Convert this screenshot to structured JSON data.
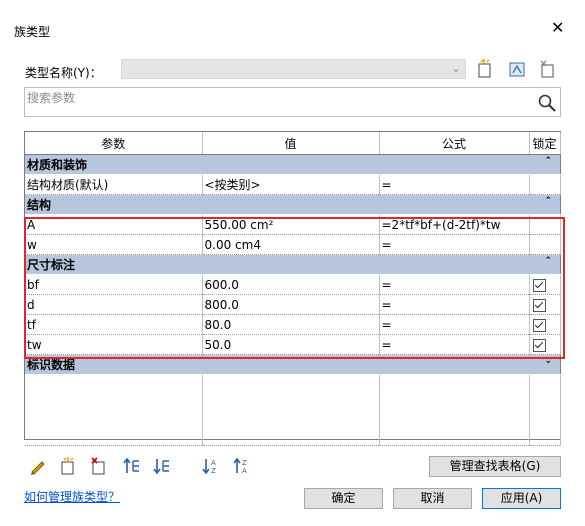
{
  "window": {
    "title": "族类型",
    "close_glyph": "✕"
  },
  "type_name": {
    "label": "类型名称(Y)：",
    "value": ""
  },
  "search": {
    "placeholder": "搜索参数"
  },
  "grid": {
    "headers": [
      "参数",
      "值",
      "公式",
      "锁定"
    ],
    "groups": [
      {
        "label": "材质和装饰",
        "caret": "⌃",
        "rows": [
          {
            "param": "结构材质(默认)",
            "value": "<按类别>",
            "formula": "=",
            "locked": false
          }
        ]
      },
      {
        "label": "结构",
        "caret": "⌃",
        "rows": [
          {
            "param": "A",
            "value": "550.00 cm²",
            "formula": "=2*tf*bf+(d-2tf)*tw",
            "locked": false
          },
          {
            "param": "w",
            "value": "0.00 cm4",
            "formula": "=",
            "locked": false
          }
        ]
      },
      {
        "label": "尺寸标注",
        "caret": "⌃",
        "rows": [
          {
            "param": "bf",
            "value": "600.0",
            "formula": "=",
            "locked": true
          },
          {
            "param": "d",
            "value": "800.0",
            "formula": "=",
            "locked": true
          },
          {
            "param": "tf",
            "value": "80.0",
            "formula": "=",
            "locked": true
          },
          {
            "param": "tw",
            "value": "50.0",
            "formula": "=",
            "locked": true
          }
        ]
      },
      {
        "label": "标识数据",
        "caret": "⌄",
        "rows": []
      }
    ]
  },
  "buttons": {
    "lookup_tables": "管理查找表格(G)",
    "ok": "确定",
    "cancel": "取消",
    "apply": "应用(A)"
  },
  "help_link": "如何管理族类型？",
  "icons": {
    "toolbar": [
      "new-type-icon",
      "rename-type-icon",
      "delete-type-icon"
    ],
    "bottom": [
      "edit-parameter-icon",
      "new-parameter-icon",
      "delete-parameter-icon",
      "move-up-icon",
      "move-down-icon",
      "sort-ascending-icon",
      "sort-descending-icon"
    ]
  },
  "colors": {
    "group_header": "#b7c6dc",
    "highlight": "#e0262b",
    "link": "#0050d0"
  }
}
